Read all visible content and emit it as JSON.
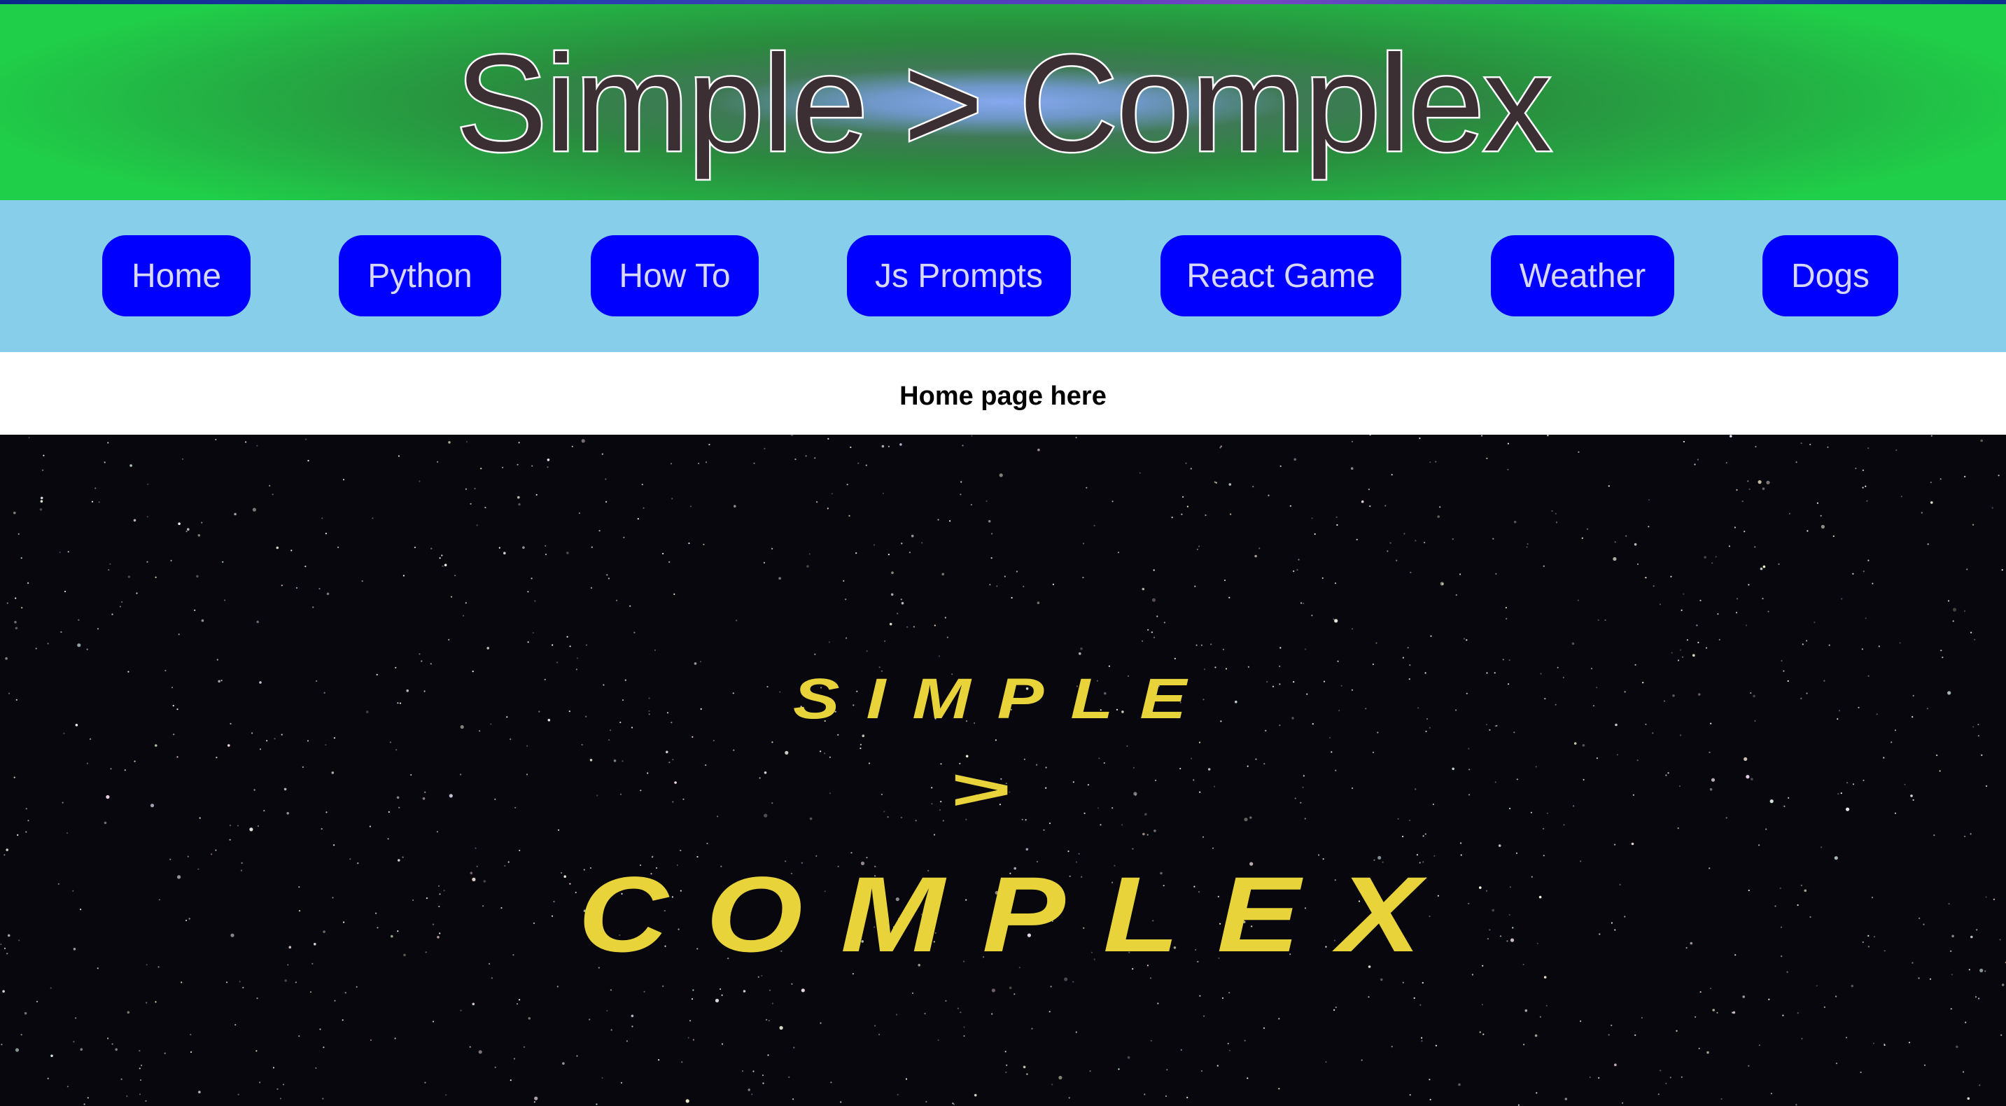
{
  "banner": {
    "title": "Simple > Complex"
  },
  "nav": {
    "items": [
      {
        "label": "Home"
      },
      {
        "label": "Python"
      },
      {
        "label": "How To"
      },
      {
        "label": "Js Prompts"
      },
      {
        "label": "React Game"
      },
      {
        "label": "Weather"
      },
      {
        "label": "Dogs"
      }
    ]
  },
  "content": {
    "heading": "Home page here"
  },
  "hero": {
    "line1": "SIMPLE",
    "line2": ">",
    "line3": "COMPLEX"
  },
  "colors": {
    "banner_green": "#1fcf49",
    "nav_background": "#87ceeb",
    "nav_button": "#0000ff",
    "crawl_yellow": "#e8d43a",
    "space": "#08070d"
  }
}
